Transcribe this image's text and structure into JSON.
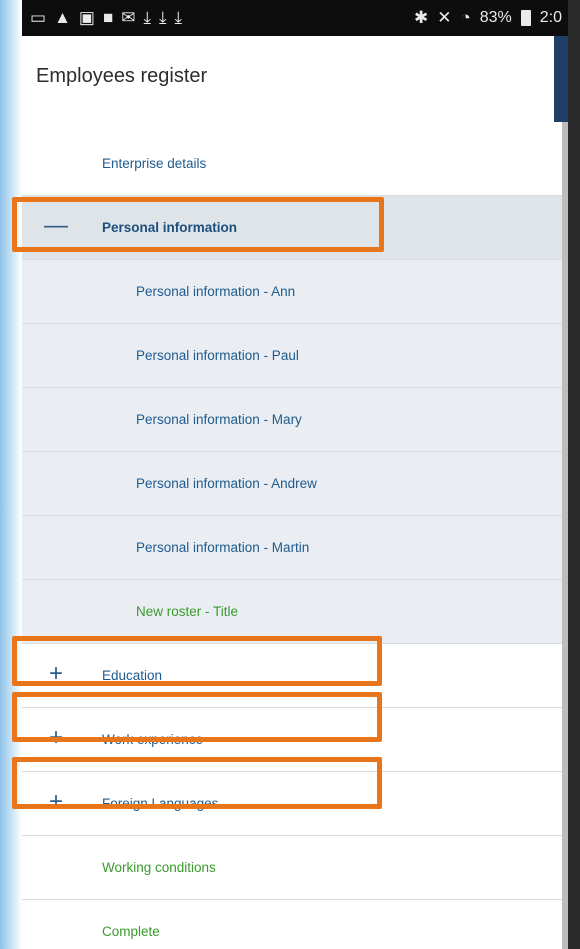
{
  "status_bar": {
    "left_icons": [
      "message-icon",
      "warning-icon",
      "image-icon",
      "youtube-icon",
      "mail-icon",
      "download-icon",
      "download-icon",
      "download-icon"
    ],
    "battery_text": "83%",
    "time": "2:0"
  },
  "header": {
    "title": "Employees register"
  },
  "menu": {
    "items": [
      {
        "label": "Enterprise details"
      },
      {
        "label": "Personal information",
        "toggle": "—"
      },
      {
        "label": "Personal information - Ann"
      },
      {
        "label": "Personal information - Paul"
      },
      {
        "label": "Personal information - Mary"
      },
      {
        "label": "Personal information - Andrew"
      },
      {
        "label": "Personal information - Martin"
      },
      {
        "label": "New roster - Title"
      },
      {
        "label": "Education",
        "toggle": "+"
      },
      {
        "label": "Work experience",
        "toggle": "+"
      },
      {
        "label": "Foreign Languages",
        "toggle": "+"
      },
      {
        "label": "Working conditions"
      },
      {
        "label": "Complete"
      }
    ]
  },
  "colors": {
    "highlight": "#e8751a",
    "link_blue": "#1e5a8c",
    "link_green": "#3a9a2e"
  }
}
